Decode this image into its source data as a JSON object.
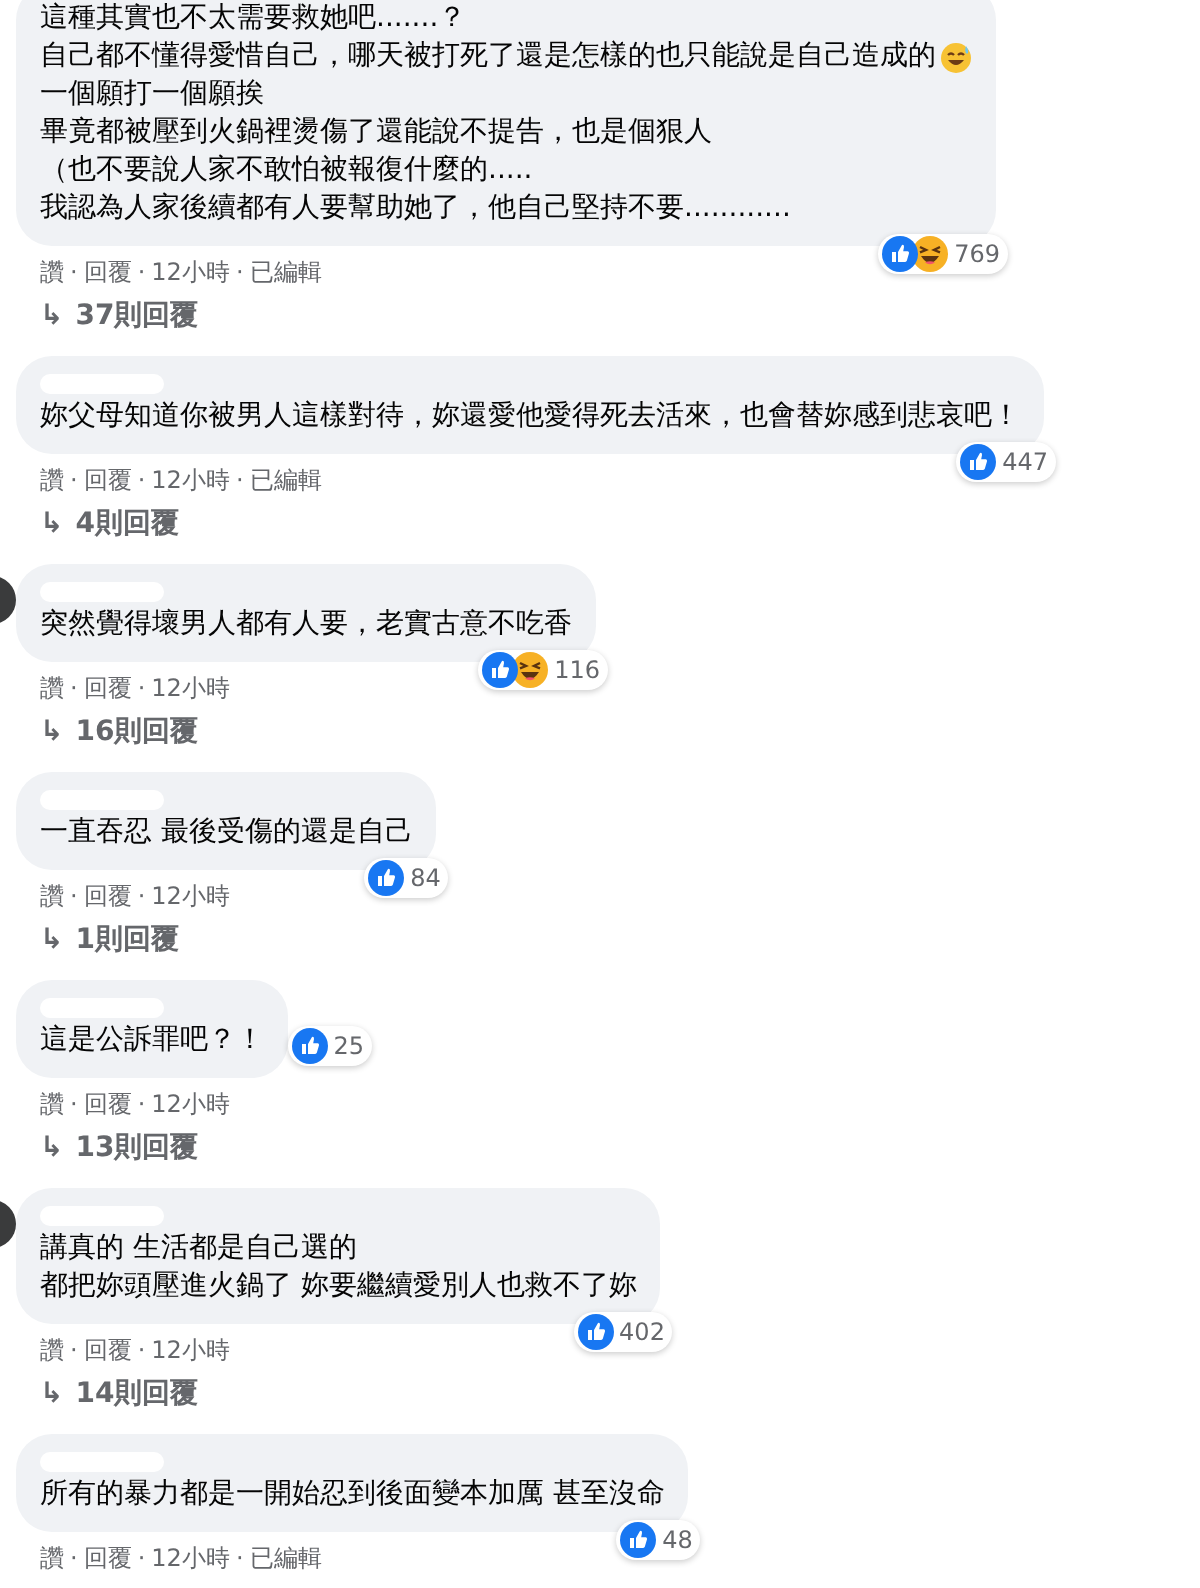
{
  "separator": "·",
  "comments": [
    {
      "name_redacted": false,
      "avatar": false,
      "lines": [
        {
          "text": "這種其實也不太需要救她吧.......？"
        },
        {
          "text": "自己都不懂得愛惜自己，哪天被打死了還是怎樣的也只能說是自己造成的",
          "emoji": {
            "kind": "sweat-smile"
          }
        },
        {
          "text": "一個願打一個願挨"
        },
        {
          "text": "畢竟都被壓到火鍋裡燙傷了還能說不提告，也是個狠人"
        },
        {
          "text": "（也不要說人家不敢怕被報復什麼的....."
        },
        {
          "text": "我認為人家後續都有人要幫助她了，他自己堅持不要............"
        }
      ],
      "reactions": [
        {
          "kind": "like"
        },
        {
          "kind": "haha"
        }
      ],
      "count": "769",
      "actions": [
        "讚",
        "回覆",
        "12小時",
        "已編輯"
      ],
      "replies_arrow": "↳",
      "replies": "37則回覆"
    },
    {
      "name_redacted": true,
      "avatar": false,
      "lines": [
        {
          "text": "妳父母知道你被男人這樣對待，妳還愛他愛得死去活來，也會替妳感到悲哀吧！"
        }
      ],
      "reactions": [
        {
          "kind": "like"
        }
      ],
      "count": "447",
      "actions": [
        "讚",
        "回覆",
        "12小時",
        "已編輯"
      ],
      "replies_arrow": "↳",
      "replies": "4則回覆"
    },
    {
      "name_redacted": true,
      "avatar": true,
      "lines": [
        {
          "text": "突然覺得壞男人都有人要，老實古意不吃香"
        }
      ],
      "reactions": [
        {
          "kind": "like"
        },
        {
          "kind": "haha"
        }
      ],
      "count": "116",
      "actions": [
        "讚",
        "回覆",
        "12小時"
      ],
      "replies_arrow": "↳",
      "replies": "16則回覆"
    },
    {
      "name_redacted": true,
      "avatar": false,
      "lines": [
        {
          "text": "一直吞忍 最後受傷的還是自己"
        }
      ],
      "reactions": [
        {
          "kind": "like"
        }
      ],
      "count": "84",
      "actions": [
        "讚",
        "回覆",
        "12小時"
      ],
      "replies_arrow": "↳",
      "replies": "1則回覆"
    },
    {
      "name_redacted": true,
      "avatar": false,
      "lines": [
        {
          "text": "這是公訴罪吧？！"
        }
      ],
      "reactions": [
        {
          "kind": "like"
        }
      ],
      "count": "25",
      "actions": [
        "讚",
        "回覆",
        "12小時"
      ],
      "replies_arrow": "↳",
      "replies": "13則回覆"
    },
    {
      "name_redacted": true,
      "avatar": true,
      "lines": [
        {
          "text": "講真的 生活都是自己選的"
        },
        {
          "text": "都把妳頭壓進火鍋了 妳要繼續愛別人也救不了妳"
        }
      ],
      "reactions": [
        {
          "kind": "like"
        }
      ],
      "count": "402",
      "actions": [
        "讚",
        "回覆",
        "12小時"
      ],
      "replies_arrow": "↳",
      "replies": "14則回覆"
    },
    {
      "name_redacted": true,
      "avatar": false,
      "lines": [
        {
          "text": "所有的暴力都是一開始忍到後面變本加厲 甚至沒命"
        }
      ],
      "reactions": [
        {
          "kind": "like"
        }
      ],
      "count": "48",
      "actions": [
        "讚",
        "回覆",
        "12小時",
        "已編輯"
      ]
    }
  ]
}
